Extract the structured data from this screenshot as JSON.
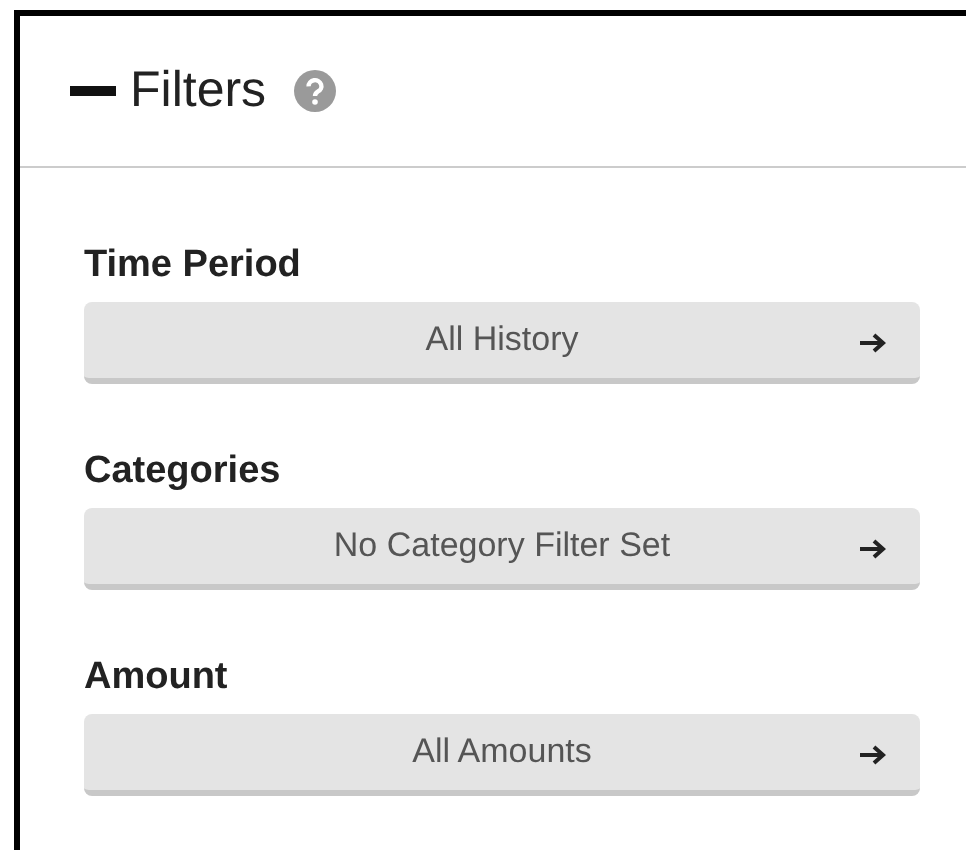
{
  "panel": {
    "title": "Filters",
    "expanded": true
  },
  "filters": [
    {
      "label": "Time Period",
      "value": "All History"
    },
    {
      "label": "Categories",
      "value": "No Category Filter Set"
    },
    {
      "label": "Amount",
      "value": "All Amounts"
    }
  ]
}
